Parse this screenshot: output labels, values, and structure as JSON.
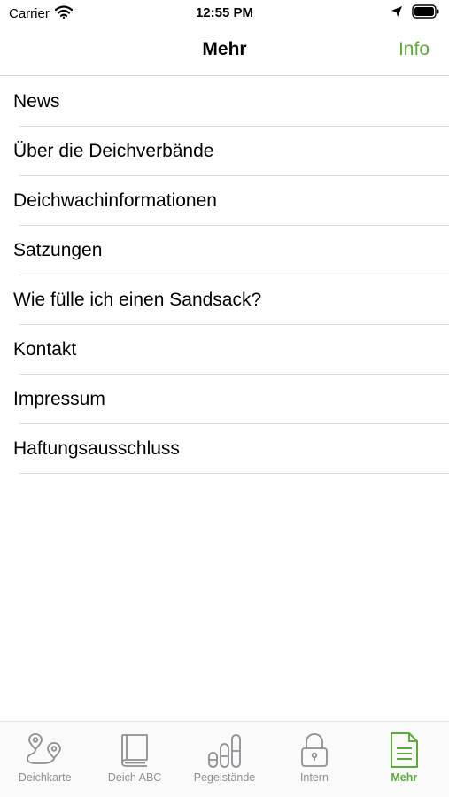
{
  "status_bar": {
    "carrier": "Carrier",
    "time": "12:55 PM"
  },
  "nav": {
    "title": "Mehr",
    "info_label": "Info"
  },
  "menu": [
    {
      "label": "News"
    },
    {
      "label": "Über die Deichverbände"
    },
    {
      "label": "Deichwachinformationen"
    },
    {
      "label": "Satzungen"
    },
    {
      "label": "Wie fülle ich einen Sandsack?"
    },
    {
      "label": "Kontakt"
    },
    {
      "label": "Impressum"
    },
    {
      "label": "Haftungsausschluss"
    }
  ],
  "tabs": [
    {
      "label": "Deichkarte",
      "icon": "map-route-icon"
    },
    {
      "label": "Deich ABC",
      "icon": "book-icon"
    },
    {
      "label": "Pegelstände",
      "icon": "water-level-icon"
    },
    {
      "label": "Intern",
      "icon": "lock-icon"
    },
    {
      "label": "Mehr",
      "icon": "document-icon",
      "active": true
    }
  ],
  "colors": {
    "accent": "#5da93e",
    "inactive": "#8e8e93"
  }
}
